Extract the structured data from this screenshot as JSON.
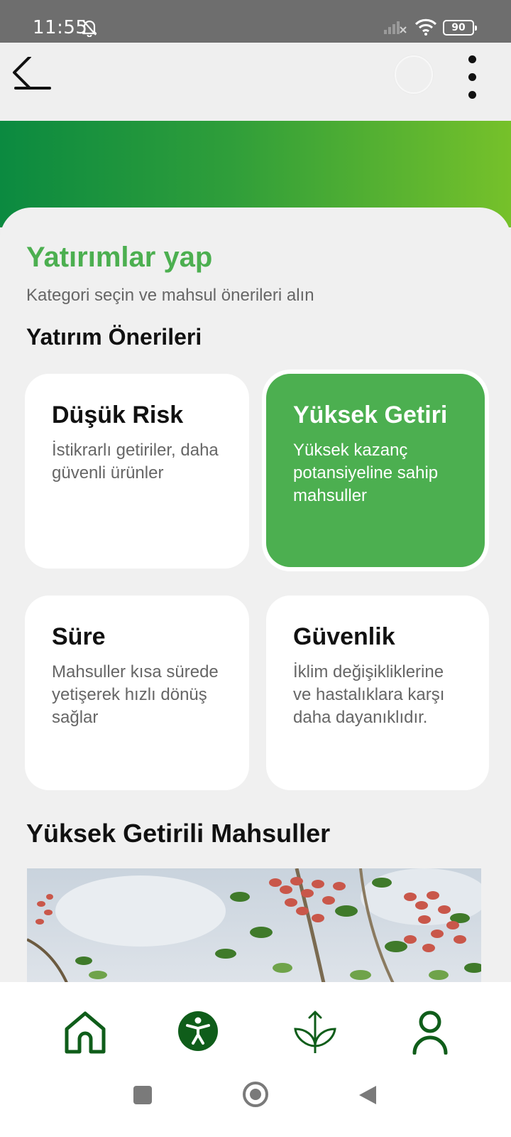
{
  "status_bar": {
    "time": "11:55",
    "battery": "90"
  },
  "header": {
    "title": "Yatırımlar yap",
    "subtitle": "Kategori seçin ve mahsul önerileri alın"
  },
  "recommendations": {
    "title": "Yatırım Önerileri",
    "cards": [
      {
        "title": "Düşük Risk",
        "description": "İstikrarlı getiriler, daha güvenli ürünler",
        "selected": false
      },
      {
        "title": "Yüksek Getiri",
        "description": "Yüksek kazanç potansiyeline sahip mahsuller",
        "selected": true
      },
      {
        "title": "Süre",
        "description": "Mahsuller kısa sürede yetişerek hızlı dönüş sağlar",
        "selected": false
      },
      {
        "title": "Güvenlik",
        "description": "İklim değişikliklerine ve hastalıklara karşı daha dayanıklıdır.",
        "selected": false
      }
    ]
  },
  "crops": {
    "title": "Yüksek Getirili Mahsuller"
  },
  "bottom_nav": {
    "items": [
      {
        "icon": "home-icon"
      },
      {
        "icon": "accessibility-icon"
      },
      {
        "icon": "plant-growth-icon"
      },
      {
        "icon": "person-icon"
      }
    ]
  },
  "colors": {
    "accent": "#4caf50",
    "dark_green": "#0f5d1a",
    "banner_start": "#0b8a40",
    "banner_end": "#76c12a"
  }
}
